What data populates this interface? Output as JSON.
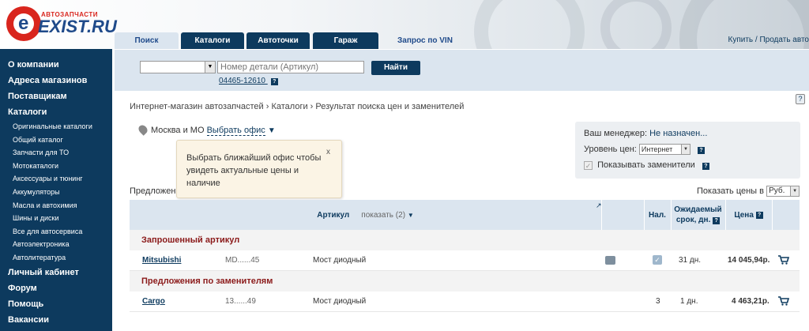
{
  "logo": {
    "small_text": "АВТОЗАПЧАСТИ",
    "brand": "EXIST.RU",
    "letter": "e"
  },
  "tabs": [
    {
      "label": "Поиск"
    },
    {
      "label": "Каталоги"
    },
    {
      "label": "Автоточки"
    },
    {
      "label": "Гараж"
    },
    {
      "label": "Запрос по VIN"
    }
  ],
  "header": {
    "buy_sell": "Купить / Продать авто"
  },
  "sidebar": {
    "items": [
      {
        "label": "О компании"
      },
      {
        "label": "Адреса магазинов"
      },
      {
        "label": "Поставщикам"
      },
      {
        "label": "Каталоги"
      }
    ],
    "subitems": [
      {
        "label": "Оригинальные каталоги"
      },
      {
        "label": "Общий каталог"
      },
      {
        "label": "Запчасти для ТО"
      },
      {
        "label": "Мотокаталоги"
      },
      {
        "label": "Аксессуары и тюнинг"
      },
      {
        "label": "Аккумуляторы"
      },
      {
        "label": "Масла и автохимия"
      },
      {
        "label": "Шины и диски"
      },
      {
        "label": "Все для автосервиса"
      },
      {
        "label": "Автоэлектроника"
      },
      {
        "label": "Автолитература"
      }
    ],
    "bottom_items": [
      {
        "label": "Личный кабинет"
      },
      {
        "label": "Форум"
      },
      {
        "label": "Помощь"
      },
      {
        "label": "Вакансии"
      }
    ]
  },
  "search": {
    "select_value": "",
    "placeholder": "Номер детали (Артикул)",
    "button": "Найти",
    "example": "04465-12610"
  },
  "breadcrumb": "Интернет-магазин автозапчастей  ›  Каталоги  ›  Результат поиска цен и заменителей",
  "location": {
    "city": "Москва и МО",
    "link": "Выбрать офис"
  },
  "popup": {
    "text": "Выбрать ближайший офис чтобы увидеть актуальные цены и наличие",
    "close": "x"
  },
  "predl_label": "Предложения",
  "manager": {
    "manager_label": "Ваш менеджер:",
    "manager_value": "Не назначен...",
    "price_level_label": "Уровень цен:",
    "price_level_value": "Интернет",
    "show_substitutes_label": "Показывать заменители"
  },
  "currency": {
    "label": "Показать цены в",
    "value": "Руб."
  },
  "table": {
    "headers": {
      "article": "Артикул",
      "show": "показать (2)",
      "availability": "Нал.",
      "expected_line1": "Ожидаемый",
      "expected_line2": "срок, дн.",
      "price": "Цена"
    },
    "sections": [
      {
        "title": "Запрошенный артикул",
        "rows": [
          {
            "brand": "Mitsubishi",
            "article": "MD......45",
            "name": "Мост диодный",
            "availability": "",
            "days": "31 дн.",
            "price": "14 045,94р."
          }
        ]
      },
      {
        "title": "Предложения по заменителям",
        "rows": [
          {
            "brand": "Cargo",
            "article": "13......49",
            "name": "Мост диодный",
            "availability": "3",
            "days": "1 дн.",
            "price": "4 463,21р."
          }
        ]
      }
    ]
  },
  "colors": {
    "navy": "#0d3a5e",
    "light_blue": "#dbe5ef",
    "accent_red": "#d9251d",
    "section_red": "#8b1a1a"
  }
}
